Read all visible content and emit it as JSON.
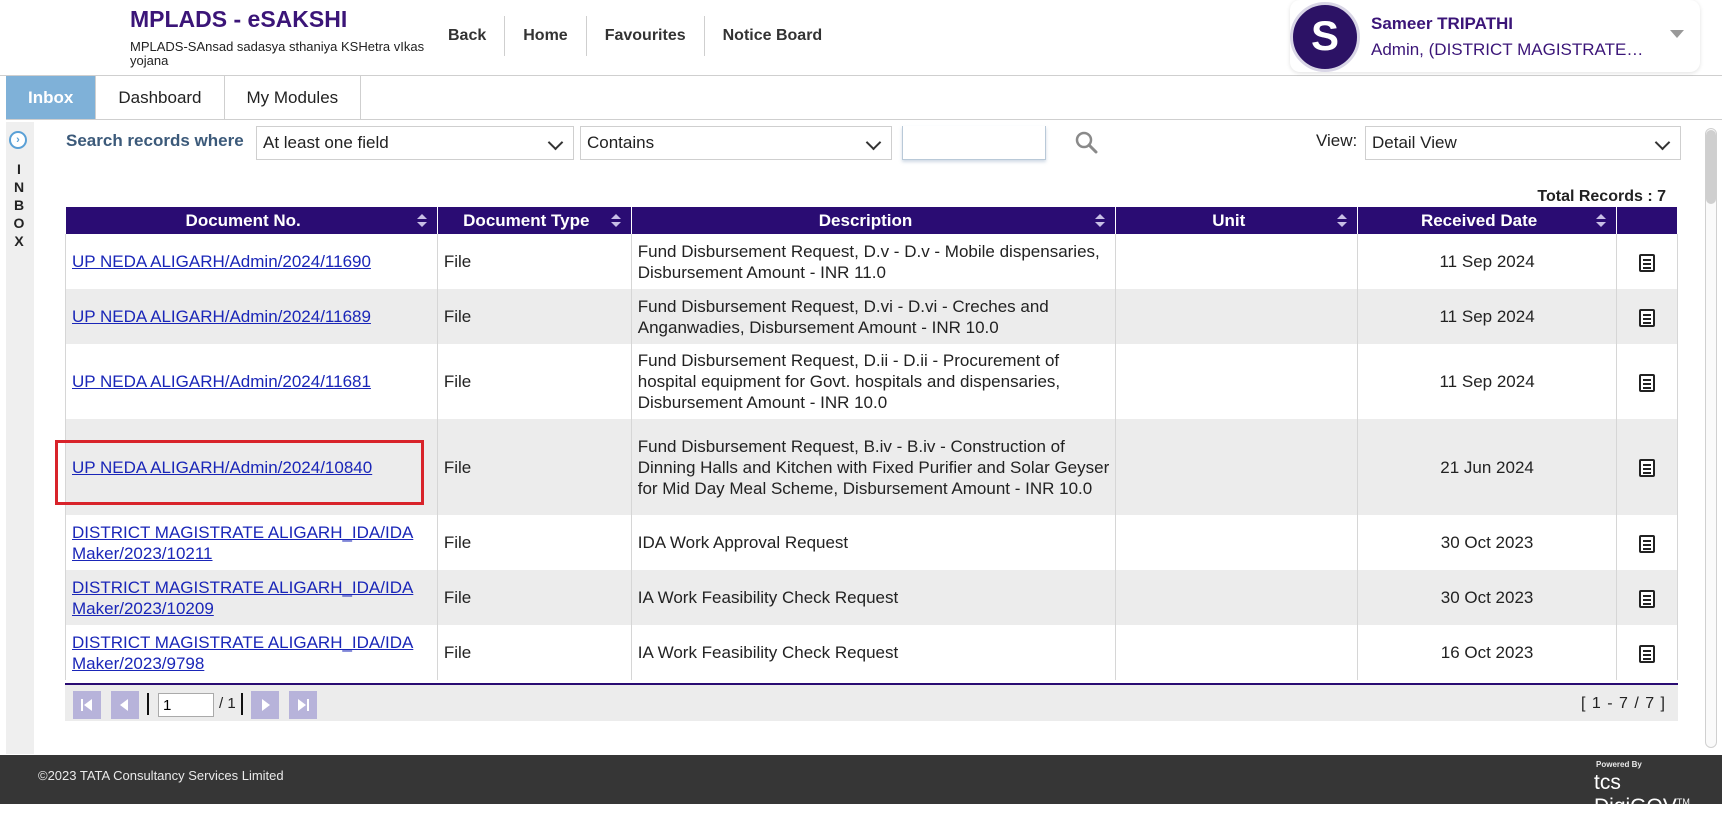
{
  "header": {
    "title": "MPLADS - eSAKSHI",
    "subtitle": "MPLADS-SAnsad sadasya sthaniya KSHetra vIkas yojana",
    "nav": [
      "Back",
      "Home",
      "Favourites",
      "Notice Board"
    ]
  },
  "user": {
    "initial": "S",
    "name": "Sameer TRIPATHI",
    "role": "Admin, (DISTRICT MAGISTRATE…",
    "avatar_color": "#2c1265"
  },
  "tabs": [
    "Inbox",
    "Dashboard",
    "My Modules"
  ],
  "side": {
    "letters": "I N B O X"
  },
  "search": {
    "label": "Search records where",
    "field_select": "At least one field",
    "operator_select": "Contains",
    "query_value": "",
    "view_label": "View:",
    "view_select": "Detail View"
  },
  "total_records": "Total Records : 7",
  "table": {
    "columns": [
      "Document No.",
      "Document Type",
      "Description",
      "Unit",
      "Received Date"
    ],
    "rows": [
      {
        "doc": "UP NEDA ALIGARH/Admin/2024/11690",
        "type": "File",
        "desc": "Fund Disbursement Request, D.v - D.v - Mobile dispensaries,  Disbursement Amount - INR 11.0",
        "unit": "",
        "date": "11 Sep 2024"
      },
      {
        "doc": "UP NEDA ALIGARH/Admin/2024/11689",
        "type": "File",
        "desc": "Fund Disbursement Request, D.vi - D.vi - Creches and Anganwadies,  Disbursement Amount - INR 10.0",
        "unit": "",
        "date": "11 Sep 2024"
      },
      {
        "doc": "UP NEDA ALIGARH/Admin/2024/11681",
        "type": "File",
        "desc": "Fund Disbursement Request, D.ii - D.ii - Procurement of hospital equipment for Govt. hospitals and dispensaries,  Disbursement Amount - INR 10.0",
        "unit": "",
        "date": "11 Sep 2024"
      },
      {
        "doc": "UP NEDA ALIGARH/Admin/2024/10840",
        "type": "File",
        "desc": "Fund Disbursement Request, B.iv - B.iv - Construction of Dinning Halls and Kitchen with Fixed Purifier and Solar Geyser for Mid Day Meal Scheme,  Disbursement Amount - INR 10.0",
        "unit": "",
        "date": "21 Jun 2024"
      },
      {
        "doc": "DISTRICT MAGISTRATE ALIGARH_IDA/IDA Maker/2023/10211",
        "type": "File",
        "desc": "IDA Work Approval Request",
        "unit": "",
        "date": "30 Oct 2023"
      },
      {
        "doc": "DISTRICT MAGISTRATE ALIGARH_IDA/IDA Maker/2023/10209",
        "type": "File",
        "desc": "IA Work Feasibility Check Request",
        "unit": "",
        "date": "30 Oct 2023"
      },
      {
        "doc": "DISTRICT MAGISTRATE ALIGARH_IDA/IDA Maker/2023/9798",
        "type": "File",
        "desc": "IA Work Feasibility Check Request",
        "unit": "",
        "date": "16 Oct 2023"
      }
    ]
  },
  "pager": {
    "page": "1",
    "total": "/ 1",
    "range": "[ 1 - 7 / 7 ]"
  },
  "footer": {
    "copyright": "©2023 TATA Consultancy Services Limited",
    "powered_by": "Powered By",
    "brand": "tcs DigiGOV",
    "tm": "TM"
  },
  "colors": {
    "header_bg": "#2a0c73",
    "brand": "#3b1578",
    "tab_active": "#7fb1d8",
    "highlight": "#d8232a"
  }
}
